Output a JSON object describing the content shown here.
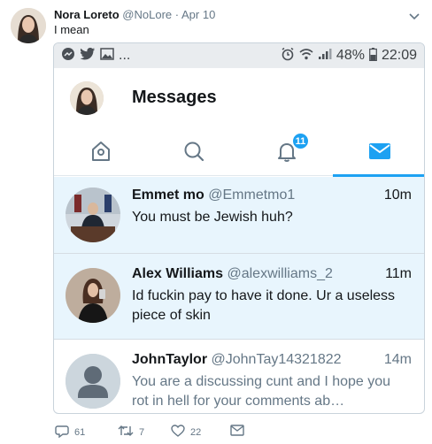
{
  "tweet": {
    "author_name": "Nora Loreto",
    "author_handle": "@NoLore",
    "separator": "·",
    "date": "Apr 10",
    "text": "I mean",
    "actions": {
      "replies": "61",
      "retweets": "7",
      "likes": "22"
    }
  },
  "phone": {
    "status_bar": {
      "overflow": "...",
      "battery": "48%",
      "time": "22:09"
    },
    "header": {
      "title": "Messages"
    },
    "nav": {
      "notifications_badge": "11",
      "active_tab": "messages"
    },
    "conversations": [
      {
        "name": "Emmet mo",
        "handle": "@Emmetmo1",
        "time": "10m",
        "preview": "You must be Jewish huh?",
        "unread": true
      },
      {
        "name": "Alex Williams",
        "handle": "@alexwilliams_2",
        "time": "11m",
        "preview": "Id fuckin pay to have it done. Ur a useless piece of skin",
        "unread": true
      },
      {
        "name": "JohnTaylor",
        "handle": "@JohnTay14321822",
        "time": "14m",
        "preview": "You are a discussing cunt and I hope you rot in hell for your comments ab…",
        "unread": false
      }
    ]
  },
  "colors": {
    "accent": "#1da1f2",
    "unread_bg": "#e8f5fd",
    "muted": "#657786"
  }
}
